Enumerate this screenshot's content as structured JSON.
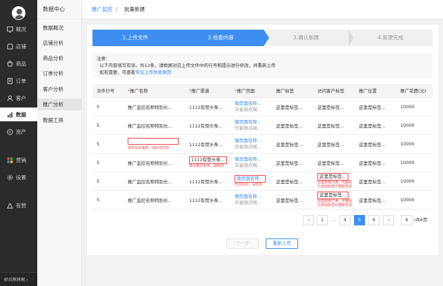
{
  "nav": {
    "items": [
      {
        "label": "概况",
        "icon": "dashboard-icon"
      },
      {
        "label": "店铺",
        "icon": "store-icon"
      },
      {
        "label": "商品",
        "icon": "goods-icon"
      },
      {
        "label": "订单",
        "icon": "order-icon"
      },
      {
        "label": "客户",
        "icon": "customer-icon"
      },
      {
        "label": "数据",
        "icon": "data-chart-icon"
      },
      {
        "label": "资产",
        "icon": "asset-icon"
      },
      {
        "label": "营销",
        "icon": "marketing-icon"
      },
      {
        "label": "设置",
        "icon": "settings-icon"
      },
      {
        "label": "有赞",
        "icon": "youzan-icon"
      }
    ],
    "footer": "虾兵熊将啊 ›"
  },
  "subnav": {
    "title": "数据中心",
    "items": [
      "数据概况",
      "店铺分析",
      "商品分析",
      "订单分析",
      "客户分析",
      "推广分析",
      "数据工具"
    ]
  },
  "breadcrumb": {
    "link": "推广监控",
    "sep": "/",
    "current": "批量新建"
  },
  "steps": [
    "1.上传文件",
    "2.检查内容",
    "3.确认新建",
    "4.新建完成"
  ],
  "notice": {
    "title": "注意：",
    "line1": "· 以下内容填写有误，共12条，请根据对应上传文件中的行号和提示进行修改，并重新上传",
    "line2_prefix": "· 如有需要，可查看",
    "line2_link": "常见上传失败原因"
  },
  "table": {
    "headers": [
      "文件行号",
      "推广名称",
      "推广渠道",
      "推广页面",
      "推广标签",
      "访问客户标签",
      "推广位置",
      "推广花费(元)"
    ],
    "rows": [
      {
        "line": "5",
        "name": "推广监控名称特别长...",
        "channel": "1112有赞头条...",
        "page_title": "微页面名称...",
        "page_sub": "华星网点网...",
        "tag": "这里是标签...",
        "visitor": "这里是标签...",
        "pos": "这里是标签...",
        "cost": "10000"
      },
      {
        "line": "5",
        "name": "推广监控名称特别长...",
        "channel": "1112有赞头条...",
        "page_title": "微页面名称...",
        "page_sub": "华星网点网...",
        "tag": "这里是标签...",
        "visitor": "这里是标签...",
        "pos": "这里是标签...",
        "cost": "10000"
      },
      {
        "line": "5",
        "name": "",
        "name_err": "该项为必填项，请补充内容",
        "channel": "1112有赞头条...",
        "page_title": "微页面名称...",
        "page_sub": "华星网点网...",
        "tag": "这里是标签...",
        "visitor": "这里是标签...",
        "pos": "这里是标签...",
        "cost": "10000"
      },
      {
        "line": "5",
        "name": "推广监控名称特别长...",
        "channel": "1112有赞头条...",
        "channel_err": "填写格式有误，请修改",
        "page_title": "微页面名称...",
        "page_sub": "华星网点网...",
        "tag": "这里是标签...",
        "visitor": "这里是标签...",
        "pos": "这里是标签...",
        "cost": "10000"
      },
      {
        "line": "5",
        "name": "推广监控名称特别长...",
        "channel": "1112有赞头条...",
        "page_title": "微页面名称...",
        "page_err": "无法识别，请修改",
        "tag": "这里是标签...",
        "visitor": "这里是标签...",
        "visitor_err": "标签数量已满，可删除已添加标签并重新尝试",
        "pos": "这里是标签...",
        "cost": "10000"
      },
      {
        "line": "5",
        "name": "推广监控名称特别长...",
        "channel": "1112有赞头条...",
        "page_title": "微页面名称...",
        "page_sub": "华星网点网...",
        "tag": "这里是标签...",
        "visitor": "这里是标签...",
        "visitor_err": "标签数量已满，可删除已添加标签并重新尝试",
        "pos": "这里是标签...",
        "cost": "10000"
      }
    ]
  },
  "pagination": {
    "prev": "‹",
    "first": "1",
    "dots": "...",
    "p4": "4",
    "p5": "5",
    "p6": "6",
    "next": "›",
    "input": "6",
    "total": "/共6页"
  },
  "buttons": {
    "prev_step": "下一步",
    "reupload": "重新上传"
  },
  "colors": {
    "primary": "#3d8ef0",
    "error": "#ff4444",
    "nav_bg": "#2b2b2b"
  }
}
